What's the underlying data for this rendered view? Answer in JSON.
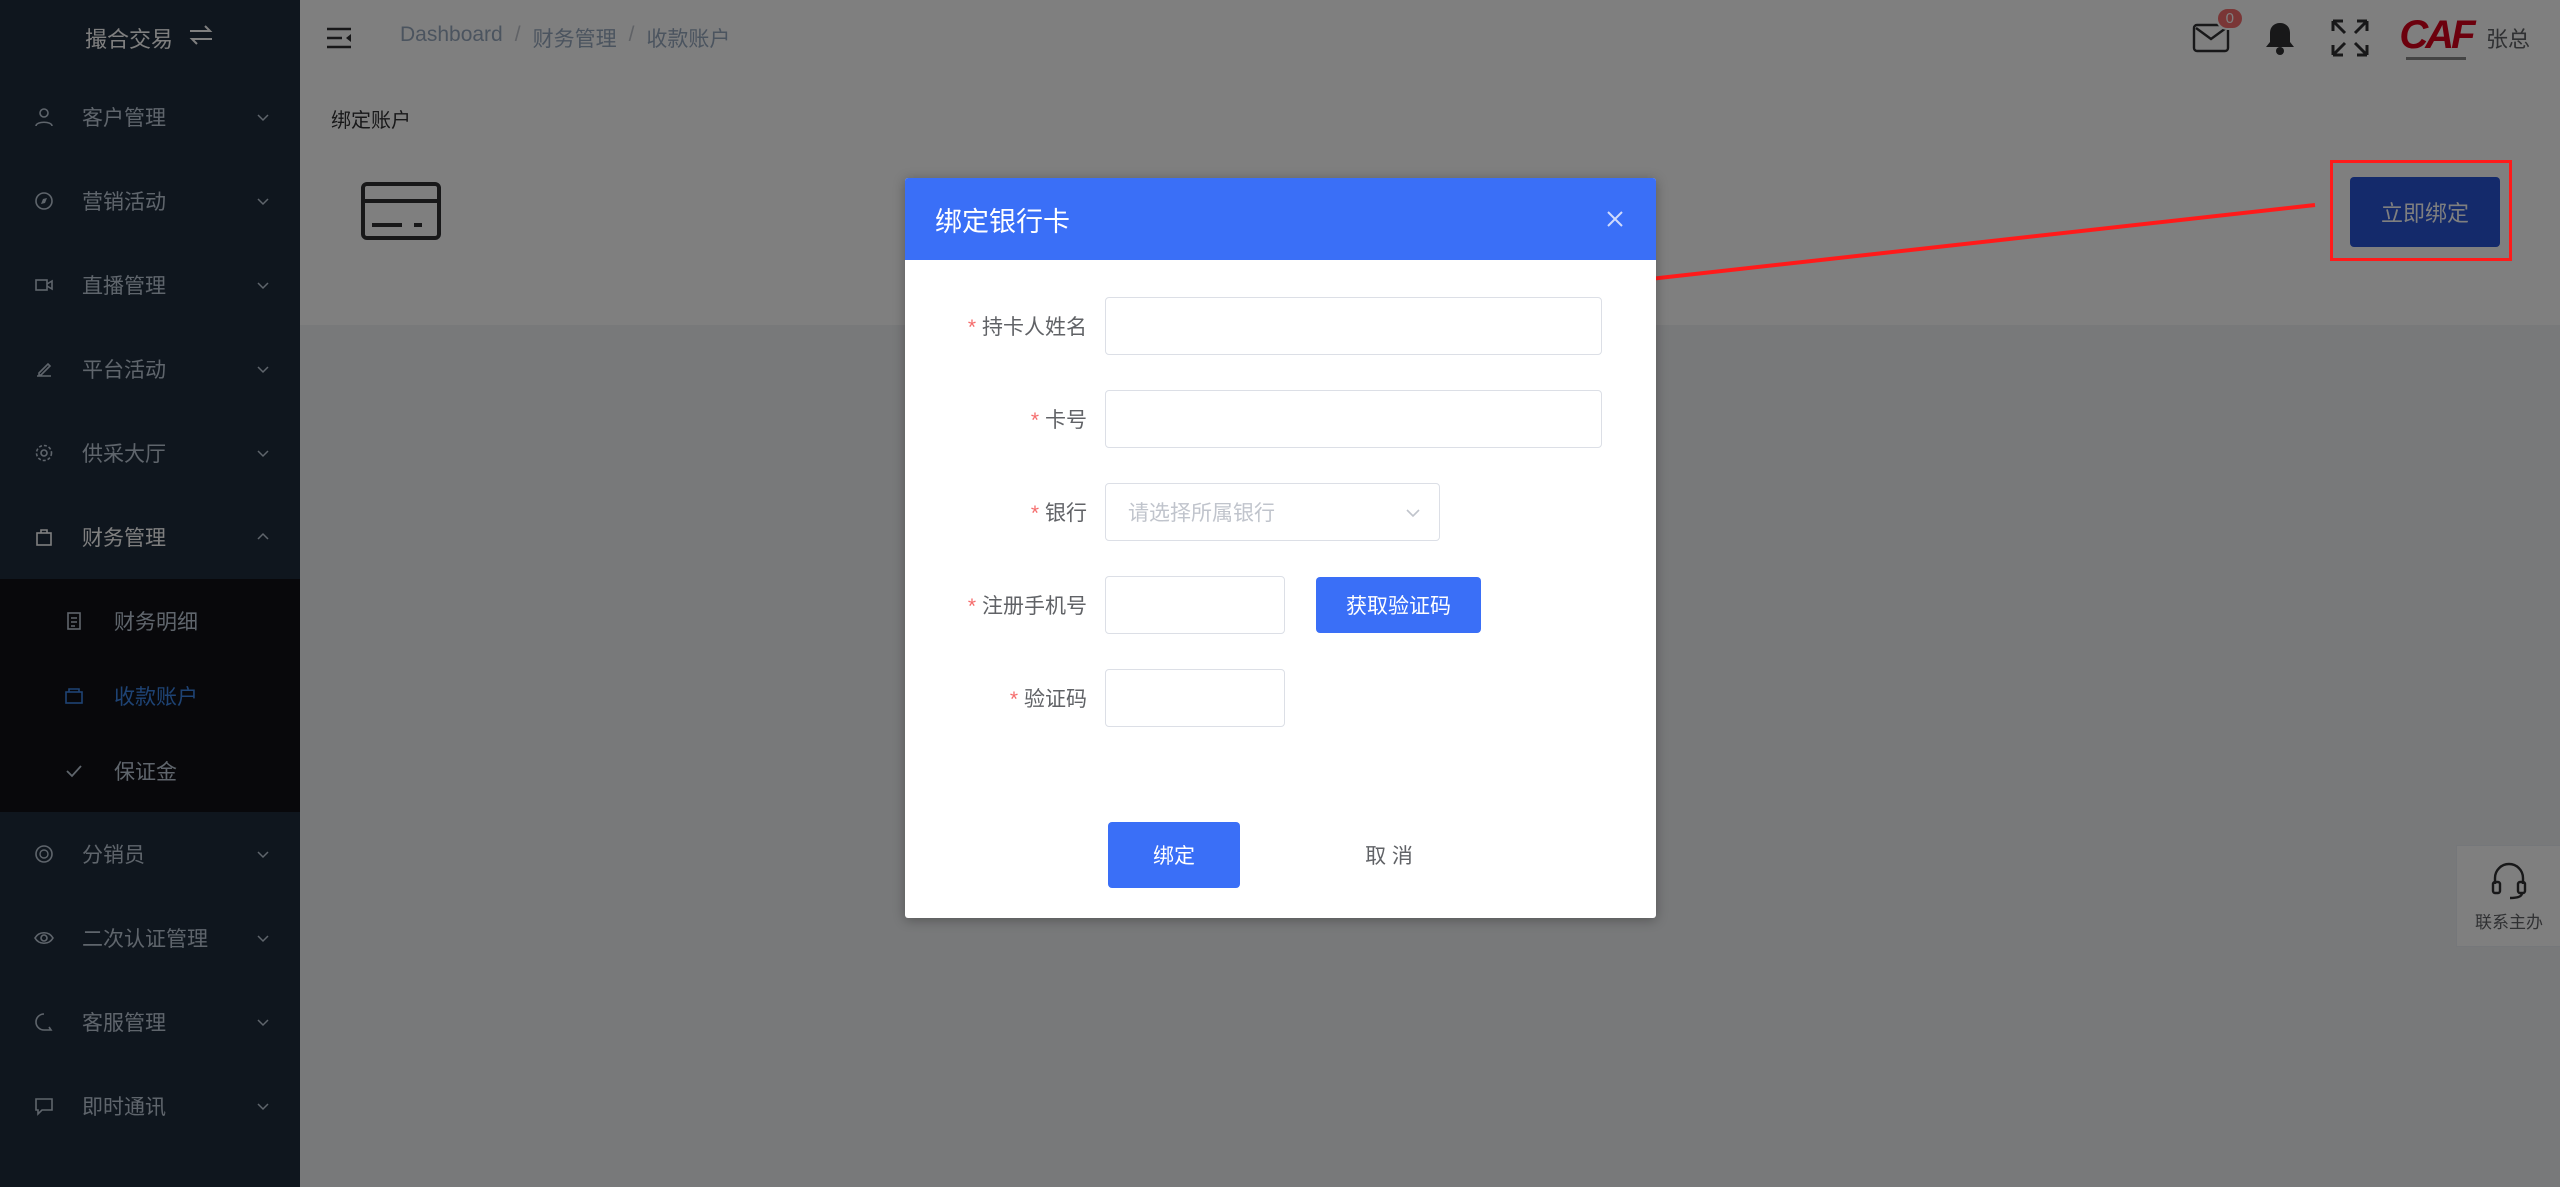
{
  "sidebar": {
    "brand": "撮合交易",
    "items": [
      {
        "label": "客户管理",
        "icon": "user-icon"
      },
      {
        "label": "营销活动",
        "icon": "compass-icon"
      },
      {
        "label": "直播管理",
        "icon": "video-icon"
      },
      {
        "label": "平台活动",
        "icon": "pen-icon"
      },
      {
        "label": "供采大厅",
        "icon": "gear-icon"
      },
      {
        "label": "财务管理",
        "icon": "bag-icon",
        "expanded": true
      }
    ],
    "sub_items": [
      {
        "label": "财务明细",
        "icon": "document-icon"
      },
      {
        "label": "收款账户",
        "icon": "wallet-icon",
        "active": true
      },
      {
        "label": "保证金",
        "icon": "check-icon"
      }
    ],
    "items_after": [
      {
        "label": "分销员",
        "icon": "coin-icon"
      },
      {
        "label": "二次认证管理",
        "icon": "eye-icon"
      },
      {
        "label": "客服管理",
        "icon": "chat-icon"
      },
      {
        "label": "即时通讯",
        "icon": "message-icon"
      }
    ]
  },
  "header": {
    "breadcrumb": [
      "Dashboard",
      "财务管理",
      "收款账户"
    ],
    "mail_badge": "0",
    "logo_text": "CAF",
    "username": "张总"
  },
  "content": {
    "title": "绑定账户",
    "bind_now": "立即绑定",
    "contact": "联系主办"
  },
  "dialog": {
    "title": "绑定银行卡",
    "fields": {
      "holder_name_label": "持卡人姓名",
      "card_no_label": "卡号",
      "bank_label": "银行",
      "bank_placeholder": "请选择所属银行",
      "phone_label": "注册手机号",
      "code_label": "验证码"
    },
    "get_code": "获取验证码",
    "confirm": "绑定",
    "cancel": "取 消"
  },
  "colors": {
    "primary": "#3a6ff7",
    "sidebar_bg": "#1f2d3d",
    "active_menu": "#3d86e8",
    "required": "#f56c6c",
    "annotation": "#ff1a1a"
  }
}
